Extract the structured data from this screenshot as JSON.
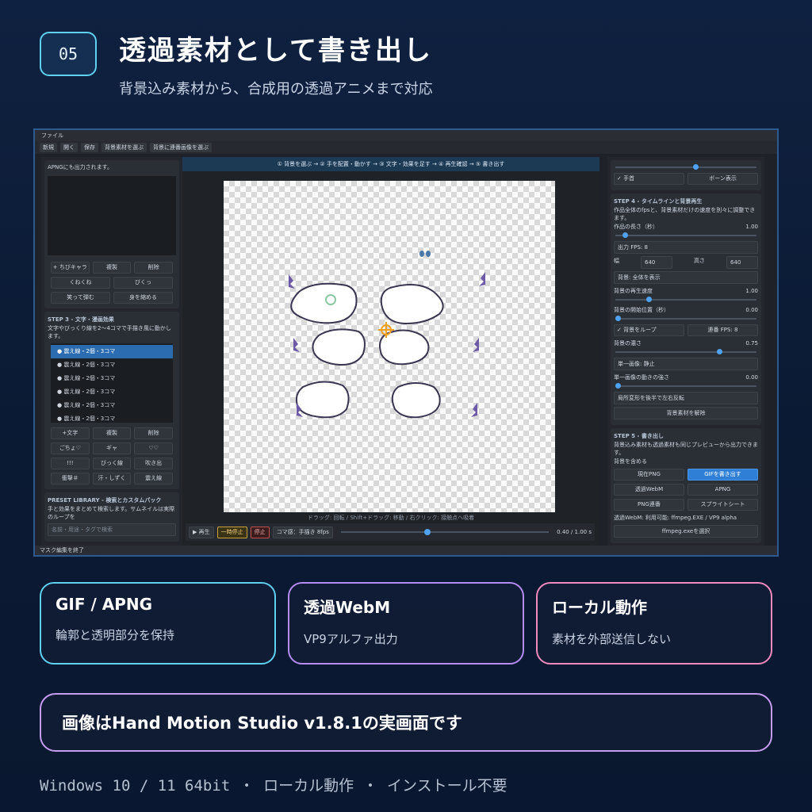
{
  "header": {
    "badge": "05",
    "title": "透過素材として書き出し",
    "subtitle": "背景込み素材から、合成用の透過アニメまで対応"
  },
  "app": {
    "menu": "ファイル",
    "toolbar": [
      "新規",
      "開く",
      "保存",
      "背景素材を選ぶ",
      "背景に連番画像を選ぶ"
    ],
    "left": {
      "intro_text": "APNGにも出力されます。",
      "buttons_row1": [
        "+ ちびキャラ",
        "複製",
        "削除"
      ],
      "buttons_row2": [
        "くねくね",
        "びくっ"
      ],
      "buttons_row3": [
        "笑って弾む",
        "身を縮める"
      ],
      "step3_title": "STEP 3 - 文字・漫画効果",
      "step3_desc": "文字やびっくり線を2〜4コマで手描き風に動かします。",
      "list": [
        "震え線・2個・3コマ",
        "震え線・2個・3コマ",
        "震え線・2個・3コマ",
        "震え線・2個・3コマ",
        "震え線・2個・3コマ",
        "震え線・2個・3コマ"
      ],
      "fx_row1": [
        "+文字",
        "複製",
        "削除"
      ],
      "fx_row2": [
        "ごちょ♡",
        "ギャ",
        "♡♡"
      ],
      "fx_row3": [
        "!!!",
        "びっく線",
        "吹き出"
      ],
      "fx_row4": [
        "衝撃＃",
        "汗・しずく",
        "震え線"
      ],
      "preset_title": "PRESET LIBRARY - 検索とカスタムパック",
      "preset_desc": "手と効果をまとめて検索します。サムネイルは実際のループを",
      "search_placeholder": "名前・用途・タグで検索"
    },
    "center": {
      "steps": "① 背景を選ぶ → ② 手を配置・動かす → ③ 文字・効果を足す → ④ 再生確認 → ⑤ 書き出す",
      "hint": "ドラッグ: 回転 / Shift+ドラッグ: 移動 / 右クリック: 接触点へ吸着",
      "play": "▶ 再生",
      "pause": "一時停止",
      "stop": "停止",
      "koma": "コマ感：手描き 8fps",
      "time": "0.40 / 1.00 s"
    },
    "right": {
      "check_hand": "✓ 手首",
      "bone": "ボーン表示",
      "step4_title": "STEP 4 - タイムラインと背景再生",
      "step4_desc": "作品全体のfpsと、背景素材だけの速度を別々に調整できます。",
      "length_label": "作品の長さ（秒）",
      "length_value": "1.00",
      "fps": "出力 FPS: 8",
      "width_label": "幅",
      "width_value": "640",
      "height_label": "高さ",
      "height_value": "640",
      "bg_display": "背景: 全体を表示",
      "bg_speed_label": "背景の再生速度",
      "bg_speed_value": "1.00",
      "bg_start_label": "背景の開始位置（秒）",
      "bg_start_value": "0.00",
      "bg_loop": "✓ 背景をループ",
      "seq_fps": "連番 FPS: 8",
      "bg_density_label": "背景の濃さ",
      "bg_density_value": "0.75",
      "single_image": "単一画像: 静止",
      "single_move_label": "単一画像の動きの強さ",
      "single_move_value": "0.00",
      "flip": "局所変形を後半で左右反転",
      "release": "背景素材を解除",
      "step5_title": "STEP 5 - 書き出し",
      "step5_desc": "背景込み素材も透過素材も同じプレビューから出力できます。",
      "include_bg": "背景を含める",
      "export_buttons": [
        [
          "現在PNG",
          "GIFを書き出す"
        ],
        [
          "透過WebM",
          "APNG"
        ],
        [
          "PNG連番",
          "スプライトシート"
        ]
      ],
      "webm_note": "透過WebM: 利用可能: ffmpeg.EXE / VP9 alpha",
      "ffmpeg": "ffmpeg.exeを選択"
    },
    "status": "マスク編集を終了"
  },
  "cards": [
    {
      "title": "GIF / APNG",
      "desc": "輪郭と透明部分を保持"
    },
    {
      "title": "透過WebM",
      "desc": "VP9アルファ出力"
    },
    {
      "title": "ローカル動作",
      "desc": "素材を外部送信しない"
    }
  ],
  "banner": "画像はHand Motion Studio v1.8.1の実画面です",
  "footer": "Windows 10 / 11 64bit ・ ローカル動作 ・ インストール不要",
  "colors": {
    "accent_cyan": "#5fd0f0",
    "accent_purple": "#b48cf2",
    "accent_pink": "#f08ac0",
    "button_blue": "#2f7fd6"
  }
}
